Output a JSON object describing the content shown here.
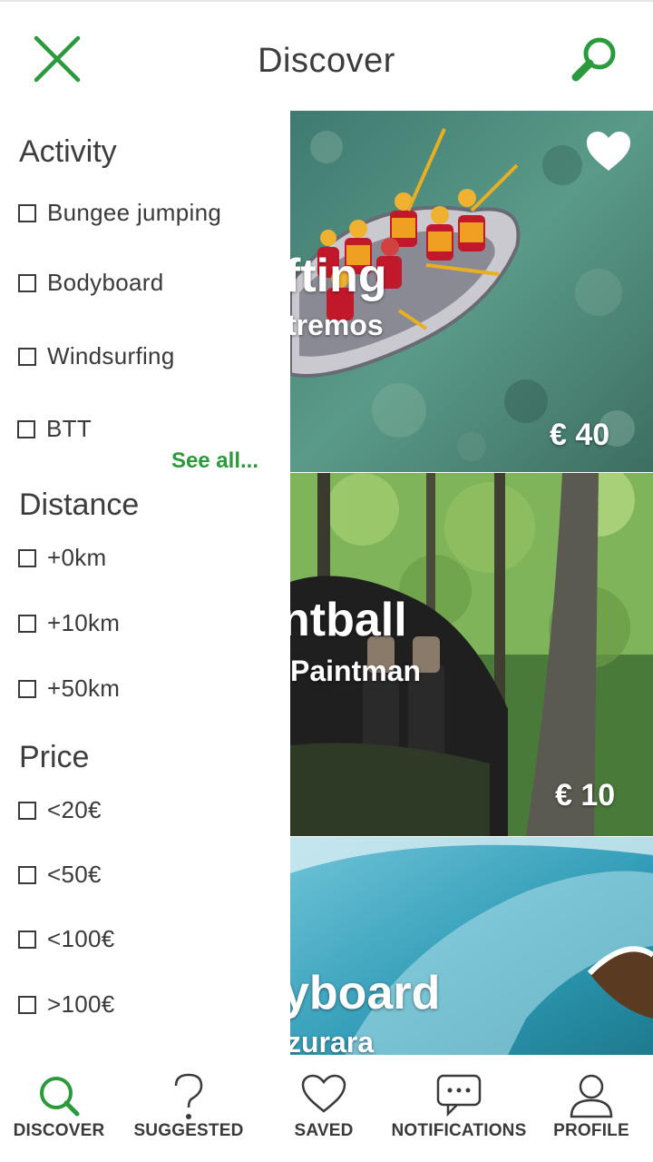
{
  "header": {
    "title": "Discover"
  },
  "filters": {
    "activity": {
      "title": "Activity",
      "options": [
        "Bungee jumping",
        "Bodyboard",
        "Windsurfing",
        "BTT"
      ],
      "see_all": "See all..."
    },
    "distance": {
      "title": "Distance",
      "options": [
        "+0km",
        "+10km",
        "+50km"
      ]
    },
    "price": {
      "title": "Price",
      "options": [
        "<20€",
        "<50€",
        "<100€",
        ">100€"
      ]
    }
  },
  "cards": [
    {
      "title": "fting",
      "subtitle": "tremos",
      "price": "€ 40",
      "favorite_icon": "heart-icon"
    },
    {
      "title": "ntball",
      "subtitle": "Paintman",
      "price": "€ 10"
    },
    {
      "title": "yboard",
      "subtitle": "zurara",
      "price": ""
    }
  ],
  "nav": {
    "items": [
      {
        "label": "DISCOVER",
        "icon": "search-icon",
        "active": true
      },
      {
        "label": "SUGGESTED",
        "icon": "question-icon"
      },
      {
        "label": "SAVED",
        "icon": "heart-icon"
      },
      {
        "label": "NOTIFICATIONS",
        "icon": "chat-icon"
      },
      {
        "label": "PROFILE",
        "icon": "person-icon"
      }
    ]
  },
  "colors": {
    "accent": "#2a9a3c",
    "text": "#3a3a3a"
  }
}
